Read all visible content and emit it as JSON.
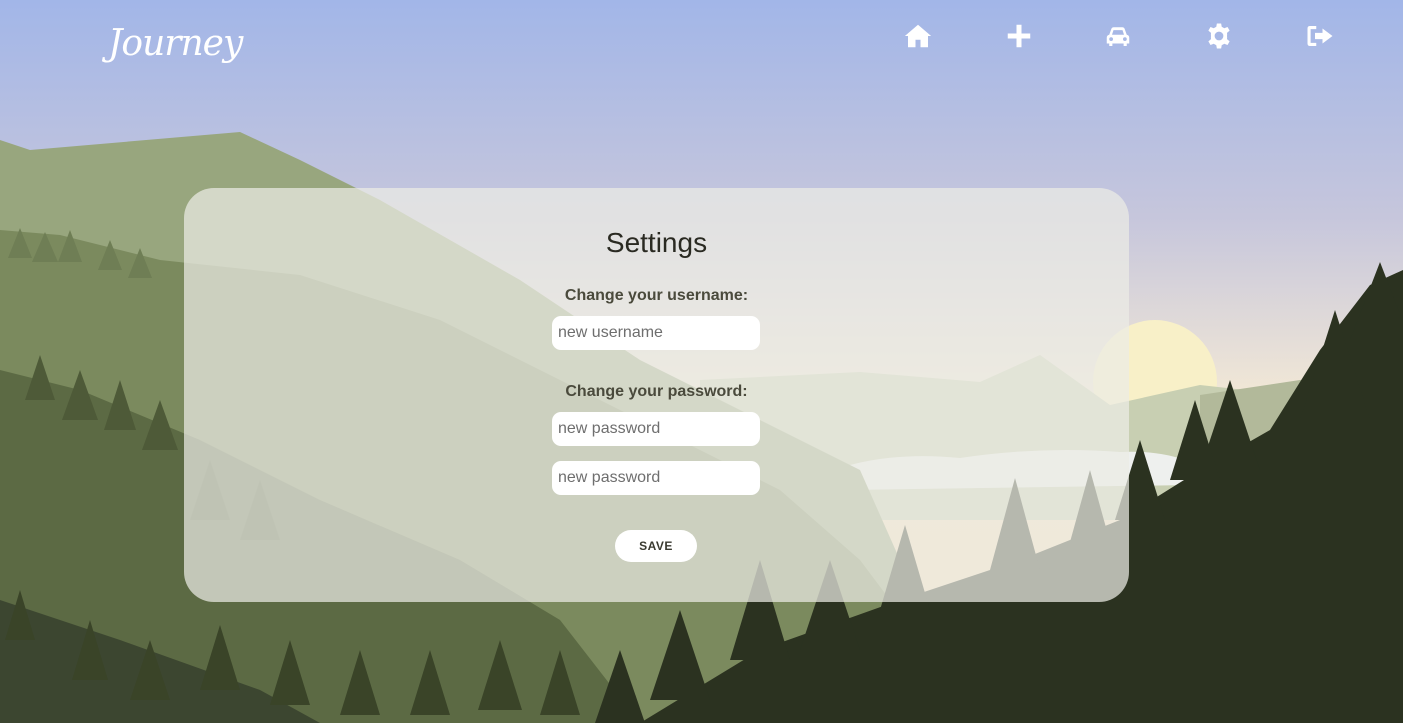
{
  "app": {
    "logo_text": "Journey"
  },
  "nav": {
    "items": [
      {
        "icon": "home-icon"
      },
      {
        "icon": "plus-icon"
      },
      {
        "icon": "car-icon"
      },
      {
        "icon": "gear-icon"
      },
      {
        "icon": "logout-icon"
      }
    ]
  },
  "settings": {
    "title": "Settings",
    "username_label": "Change your username:",
    "username_placeholder": "new username",
    "password_label": "Change your password:",
    "password_placeholder": "new password",
    "password_confirm_placeholder": "new password",
    "save_label": "SAVE"
  },
  "colors": {
    "sky_top": "#a2b6e8",
    "sky_bottom": "#f6e6cc",
    "mountain_near": "#2b3220",
    "panel": "#ecece4",
    "text": "#2a2a22"
  }
}
